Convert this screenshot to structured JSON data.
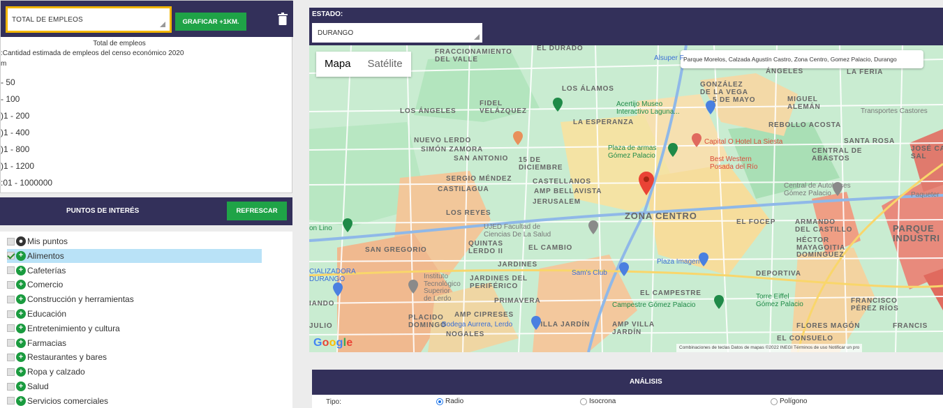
{
  "left_panel": {
    "empleos_select_value": "TOTAL DE EMPLEOS",
    "graficar_label": "GRAFICAR +1KM.",
    "legend": {
      "title": "Total de empleos",
      "subtitle": ":Cantidad estimada de empleos del censo económico 2020",
      "unit": "m",
      "ranges": [
        "- 50",
        "- 100",
        ")1 - 200",
        ")1 - 400",
        ")1 - 800",
        ")1 - 1200",
        ":01 - 1000000"
      ]
    }
  },
  "puntos_interes": {
    "title": "PUNTOS DE INTERÉS",
    "refrescar_label": "REFRESCAR",
    "items": [
      {
        "label": "Mis puntos",
        "checked": false,
        "icon": "user-icon"
      },
      {
        "label": "Alimentos",
        "checked": true,
        "icon": "plus-icon"
      },
      {
        "label": "Cafeterías",
        "checked": false,
        "icon": "plus-icon"
      },
      {
        "label": "Comercio",
        "checked": false,
        "icon": "plus-icon"
      },
      {
        "label": "Construcción y herramientas",
        "checked": false,
        "icon": "plus-icon"
      },
      {
        "label": "Educación",
        "checked": false,
        "icon": "plus-icon"
      },
      {
        "label": "Entretenimiento y cultura",
        "checked": false,
        "icon": "plus-icon"
      },
      {
        "label": "Farmacias",
        "checked": false,
        "icon": "plus-icon"
      },
      {
        "label": "Restaurantes y bares",
        "checked": false,
        "icon": "plus-icon"
      },
      {
        "label": "Ropa y calzado",
        "checked": false,
        "icon": "plus-icon"
      },
      {
        "label": "Salud",
        "checked": false,
        "icon": "plus-icon"
      },
      {
        "label": "Servicios comerciales",
        "checked": false,
        "icon": "plus-icon"
      }
    ]
  },
  "estado": {
    "label": "ESTADO:",
    "value": "DURANGO"
  },
  "map": {
    "type_options": [
      "Mapa",
      "Satélite"
    ],
    "address": "Parque Morelos, Calzada Agustín Castro, Zona Centro, Gomez Palacio, Durango",
    "google": "Google",
    "attribution": "Combinaciones de teclas   Datos de mapas ©2022 INEGI   Términos de uso   Notificar un pro",
    "labels": {
      "fracc": "FRACCIONAMIENTO\nDEL VALLE",
      "el_durado": "EL DURADO",
      "alsuper": "Alsuper F",
      "los_alamos": "LOS ÁLAMOS",
      "gonzalez": "GONZÁLEZ\nDE LA VEGA",
      "angeles": "ÁNGELES",
      "la_feria": "LA FERIA",
      "fidel": "FIDEL\nVELÁZQUEZ",
      "los_angeles": "LOS ÁNGELES",
      "acertijo": "Acertijo Museo\nInteractivo Laguna...",
      "cinco_mayo": "5 DE MAYO",
      "miguel": "MIGUEL\nALEMÁN",
      "transportes": "Transportes Castores",
      "la_esperanza": "LA ESPERANZA",
      "rebollo": "REBOLLO ACOSTA",
      "nuevo_lerdo": "NUEVO LERDO",
      "simon": "SIMÓN ZAMORA",
      "san_antonio": "SAN ANTONIO",
      "diciembre": "15 DE\nDICIEMBRE",
      "plaza_armas": "Plaza de armas\nGómez Palacio",
      "hotel": "Capital O Hotel La Siesta",
      "santa_rosa": "SANTA ROSA",
      "central_abastos": "CENTRAL DE\nABASTOS",
      "jose_ca": "JOSÉ CA\nSAL",
      "best_western": "Best Western\nPosada del Río",
      "sergio": "SERGIO MÉNDEZ",
      "castilagua": "CASTILAGUA",
      "castellanos": "CASTELLANOS",
      "bellavista": "AMP BELLAVISTA",
      "central_autobuses": "Central de Autobuses\nGómez Palacio",
      "paqueteri": "Paqueter",
      "jerusalem": "JERUSALEM",
      "zona_centro": "ZONA CENTRO",
      "los_reyes": "LOS REYES",
      "el_focep": "EL FOCEP",
      "armando": "ARMANDO\nDEL CASTILLO",
      "parque_ind": "PARQUE\nINDUSTRI",
      "on_lino": "on Lino",
      "ujed": "UJED Facultad de\nCiencias De La Salud",
      "quintas": "QUINTAS\nLERDO II",
      "el_cambio": "EL CAMBIO",
      "hector": "HÉCTOR\nMAYAGOITIA\nDOMÍNGUEZ",
      "san_gregorio": "SAN GREGORIO",
      "jardines": "JARDINES",
      "plaza_imagen": "Plaza Imagen",
      "comercializadora": "CIALIZADORA\nDURANGO",
      "sams": "Sam's Club",
      "deportiva": "DEPORTIVA",
      "instituto": "Instituto\nTecnológico\nSuperior\nde Lerdo",
      "jardines_periferico": "JARDINES DEL\nPERIFÉRICO",
      "el_campestre": "EL CAMPESTRE",
      "torre_eiffel": "Torre Eiffel\nGómez Palacio",
      "francisco_perez": "FRANCISCO\nPÉREZ RÍOS",
      "iando": "IANDO",
      "primavera": "PRIMAVERA",
      "campestre_gp": "Campestre Gómez Palacio",
      "placido": "PLACIDO\nDOMINGO",
      "cipreses": "AMP CIPRESES",
      "bodega": "Bodega Aurrera, Lerdo",
      "julio": "JULIO",
      "villa_jardin": "VILLA JARDÍN",
      "amp_villa": "AMP VILLA\nJARDÍN",
      "flores_magon": "FLORES MAGÓN",
      "francis": "FRANCIS",
      "nogales": "NOGALES",
      "el_consuelo": "EL CONSUELO"
    }
  },
  "analisis": {
    "title": "ANÁLISIS",
    "tipo_label": "Tipo:",
    "options": [
      "Radio",
      "Isocrona",
      "Polígono"
    ],
    "selected": "Radio"
  }
}
